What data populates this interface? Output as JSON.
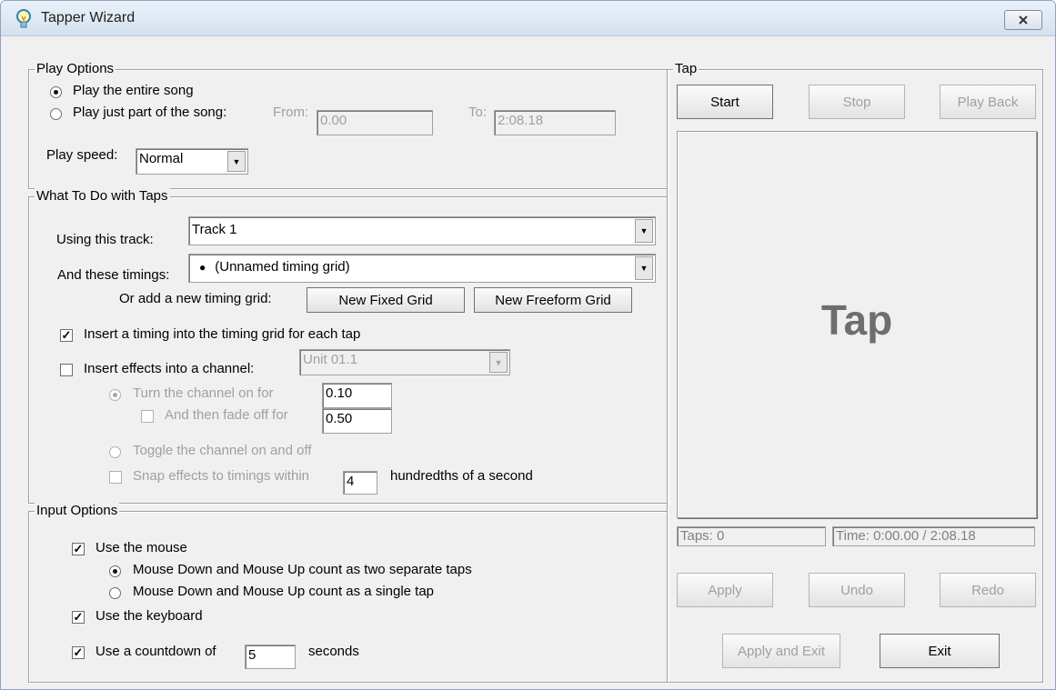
{
  "window": {
    "title": "Tapper Wizard"
  },
  "play_options": {
    "group_label": "Play Options",
    "radio_entire": "Play the entire song",
    "radio_part": "Play just part of the song:",
    "from_label": "From:",
    "from_value": "0.00",
    "to_label": "To:",
    "to_value": "2:08.18",
    "speed_label": "Play speed:",
    "speed_value": "Normal"
  },
  "taps": {
    "group_label": "What To Do with Taps",
    "track_label": "Using this track:",
    "track_value": "Track 1",
    "timings_label": "And these timings:",
    "timings_value": "(Unnamed timing grid)",
    "add_grid_label": "Or add a new timing grid:",
    "fixed_grid_button": "New Fixed Grid",
    "freeform_grid_button": "New Freeform Grid",
    "insert_timing_check": "Insert a timing into the timing grid for each tap",
    "insert_effects_check": "Insert effects into a channel:",
    "channel_value": "Unit 01.1",
    "turn_on_radio": "Turn the channel on for",
    "turn_on_value": "0.10",
    "fade_check": "And then fade off for",
    "fade_value": "0.50",
    "toggle_radio": "Toggle the channel on and off",
    "snap_check": "Snap effects to timings within",
    "snap_value": "4",
    "snap_units": "hundredths of a second"
  },
  "input_options": {
    "group_label": "Input Options",
    "use_mouse": "Use the mouse",
    "mouse_two_taps": "Mouse Down and Mouse Up count as two separate taps",
    "mouse_single_tap": "Mouse Down and Mouse Up count as a single tap",
    "use_keyboard": "Use the keyboard",
    "countdown_label": "Use a countdown of",
    "countdown_value": "5",
    "countdown_units": "seconds"
  },
  "tap_panel": {
    "group_label": "Tap",
    "start_button": "Start",
    "stop_button": "Stop",
    "playback_button": "Play Back",
    "tap_area_label": "Tap",
    "taps_status": "Taps: 0",
    "time_status": "Time: 0:00.00 / 2:08.18",
    "apply_button": "Apply",
    "undo_button": "Undo",
    "redo_button": "Redo",
    "apply_exit_button": "Apply and Exit",
    "exit_button": "Exit"
  },
  "icons": {
    "app_icon": "lightbulb-icon",
    "close_icon": "close-icon",
    "dropdown_icon": "chevron-down-icon"
  },
  "colors": {
    "window_bg": "#f0f0f0",
    "titlebar": "#dbe6f3",
    "disabled_text": "#a0a0a0",
    "tap_label": "#6e6e6e"
  }
}
